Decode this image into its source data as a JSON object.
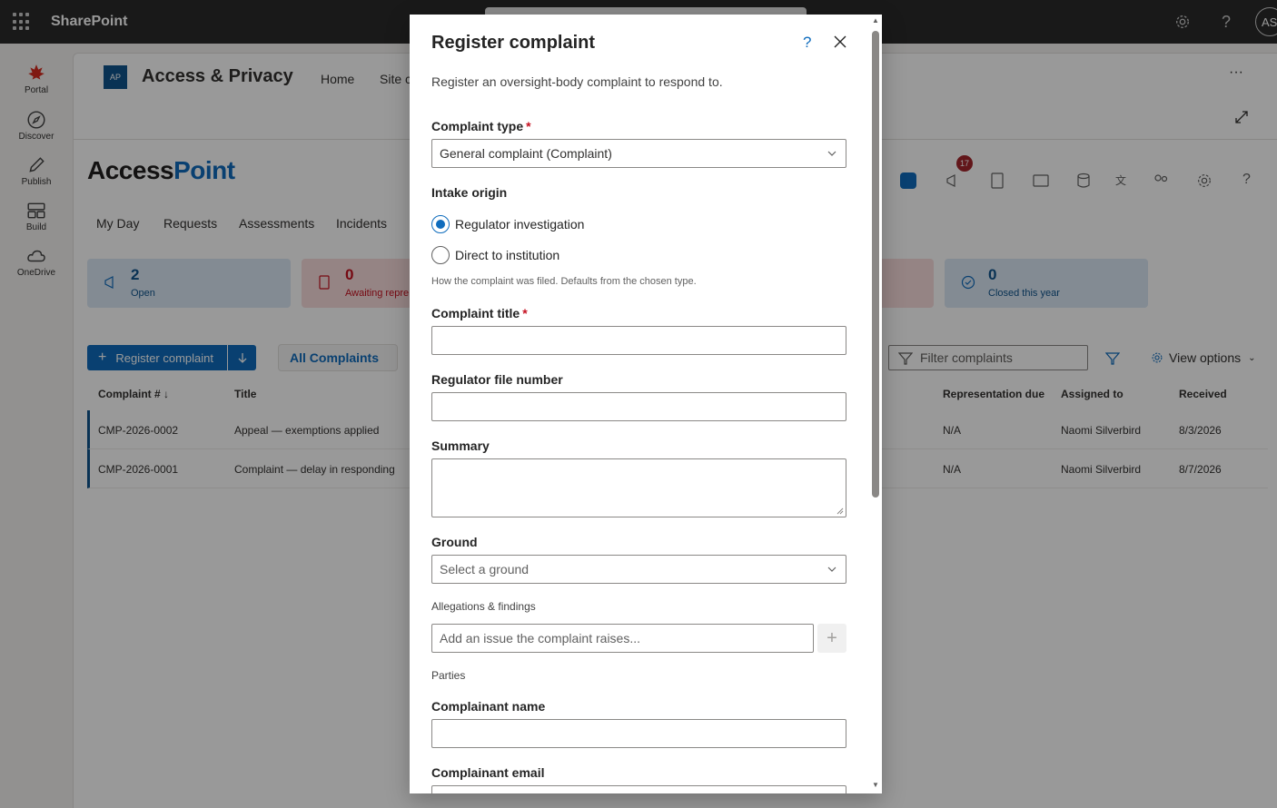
{
  "suitebar": {
    "brand": "SharePoint",
    "avatar_initials": "AS"
  },
  "appbar": [
    {
      "label": "Portal",
      "icon": "maple-leaf-icon"
    },
    {
      "label": "Discover",
      "icon": "compass-icon"
    },
    {
      "label": "Publish",
      "icon": "pen-icon"
    },
    {
      "label": "Build",
      "icon": "layout-icon"
    },
    {
      "label": "OneDrive",
      "icon": "cloud-icon"
    }
  ],
  "site": {
    "logo": "AP",
    "title": "Access & Privacy",
    "nav": [
      "Home",
      "Site c"
    ]
  },
  "app": {
    "logo_main": "Access",
    "logo_accent": "Point",
    "tabs": [
      "My Day",
      "Requests",
      "Assessments",
      "Incidents"
    ],
    "notification_count": "17"
  },
  "kpis": [
    {
      "value": "2",
      "label": "Open",
      "color": "#dbe8f5"
    },
    {
      "value": "0",
      "label": "Awaiting repre",
      "color": "#f8dcdc"
    },
    {
      "value": "0",
      "label": "Closed this year",
      "color": "#dbe8f5"
    }
  ],
  "toolbar": {
    "register_label": "Register complaint",
    "view_label": "All Complaints",
    "filter_placeholder": "Filter complaints",
    "view_options": "View options"
  },
  "table": {
    "headers": [
      "Complaint #",
      "Title",
      "Representation due",
      "Assigned to",
      "Received"
    ],
    "rows": [
      {
        "id": "CMP-2026-0002",
        "title": "Appeal — exemptions applied",
        "rep_due": "N/A",
        "assigned": "Naomi Silverbird",
        "received": "8/3/2026"
      },
      {
        "id": "CMP-2026-0001",
        "title": "Complaint — delay in responding",
        "rep_due": "N/A",
        "assigned": "Naomi Silverbird",
        "received": "8/7/2026"
      }
    ]
  },
  "dialog": {
    "title": "Register complaint",
    "description": "Register an oversight-body complaint to respond to.",
    "complaint_type_label": "Complaint type",
    "complaint_type_value": "General complaint (Complaint)",
    "intake_origin_label": "Intake origin",
    "intake_options": [
      "Regulator investigation",
      "Direct to institution"
    ],
    "intake_selected": "Regulator investigation",
    "intake_helper": "How the complaint was filed. Defaults from the chosen type.",
    "title_label": "Complaint title",
    "file_number_label": "Regulator file number",
    "summary_label": "Summary",
    "ground_label": "Ground",
    "ground_placeholder": "Select a ground",
    "allegations_label": "Allegations & findings",
    "allegations_placeholder": "Add an issue the complaint raises...",
    "parties_label": "Parties",
    "complainant_name_label": "Complainant name",
    "complainant_email_label": "Complainant email"
  }
}
